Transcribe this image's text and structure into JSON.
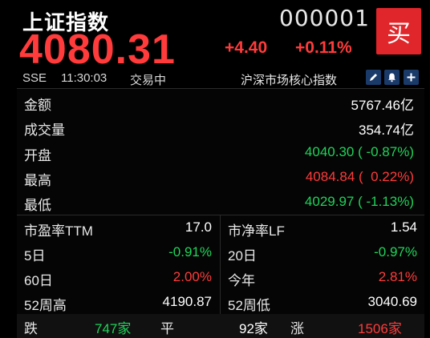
{
  "header": {
    "name": "上证指数",
    "code": "000001",
    "buy_label": "买",
    "price": "4080.31",
    "change": "+4.40",
    "change_pct": "+0.11%"
  },
  "meta": {
    "exchange": "SSE",
    "time": "11:30:03",
    "status": "交易中",
    "index_label": "沪深市场核心指数"
  },
  "toolbar": {
    "icons": [
      "edit-icon",
      "bell-icon",
      "plus-icon"
    ]
  },
  "summary": [
    {
      "label": "金额",
      "value": "5767.46亿",
      "color": "#ffffff"
    },
    {
      "label": "成交量",
      "value": "354.74亿",
      "color": "#ffffff"
    },
    {
      "label": "开盘",
      "value": "4040.30 ( -0.87%)",
      "color": "#1fd45a"
    },
    {
      "label": "最高",
      "value": "4084.84 (  0.22%)",
      "color": "#ff3b3b"
    },
    {
      "label": "最低",
      "value": "4029.97 ( -1.13%)",
      "color": "#1fd45a"
    }
  ],
  "stats": {
    "pe_label": "市盈率TTM",
    "pe_value": "17.0",
    "pb_label": "市净率LF",
    "pb_value": "1.54",
    "d5_label": "5日",
    "d5_value": "-0.91%",
    "d20_label": "20日",
    "d20_value": "-0.97%",
    "d60_label": "60日",
    "d60_value": "2.00%",
    "ytd_label": "今年",
    "ytd_value": "2.81%",
    "w52h_label": "52周高",
    "w52h_value": "4190.87",
    "w52l_label": "52周低",
    "w52l_value": "3040.69"
  },
  "breadth": {
    "down_label": "跌",
    "down_value": "747家",
    "flat_label": "平",
    "flat_value": "92家",
    "up_label": "涨",
    "up_value": "1506家"
  },
  "colors": {
    "up": "#ff3b3b",
    "down": "#1fd45a",
    "buy_button": "#e0262a"
  }
}
